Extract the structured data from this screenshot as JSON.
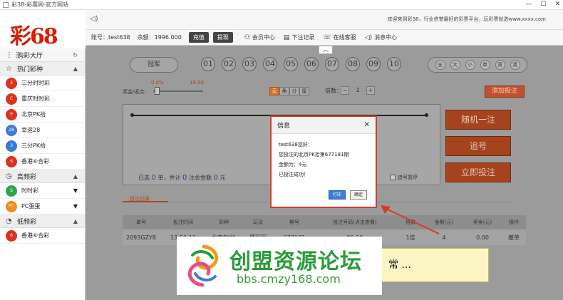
{
  "window": {
    "title": "彩38-彩票网-官方网站",
    "minimize": "—",
    "maximize": "☐",
    "close": "✕"
  },
  "logo": "彩68",
  "topbar": {
    "welcome": "欢迎来到彩38，行业信誉最好的彩票平台，玩彩票就选www.xxxx.com"
  },
  "account": {
    "user_label": "账号：test638",
    "balance_label": "余额：1996.000",
    "recharge": "充值",
    "withdraw": "提现",
    "links": [
      {
        "icon": "user-icon",
        "glyph": "⚇",
        "label": "会员中心"
      },
      {
        "icon": "book-icon",
        "glyph": "▤",
        "label": "下注记录"
      },
      {
        "icon": "headset-icon",
        "glyph": "☏",
        "label": "在线客服"
      },
      {
        "icon": "speaker-icon",
        "glyph": "◁)",
        "label": "消息中心"
      }
    ]
  },
  "sidebar": {
    "hall": "购彩大厅",
    "groups": [
      {
        "label": "热门彩种",
        "arrow": "▲",
        "icon": "star-icon",
        "glyph": "☆",
        "items": [
          "三分时时彩",
          "重庆时时彩",
          "北京PK拾",
          "幸运28",
          "三分PK拾",
          "香港⑥合彩"
        ]
      },
      {
        "label": "高频彩",
        "arrow": "▲",
        "icon": "clock-icon",
        "glyph": "◷",
        "items": [
          "时时彩",
          "PC蛋蛋"
        ]
      },
      {
        "label": "低频彩",
        "arrow": "▲",
        "icon": "timer-icon",
        "glyph": "◔",
        "items": [
          "香港⑥合彩"
        ]
      }
    ]
  },
  "game": {
    "position_pill": "冠军",
    "numbers": [
      "01",
      "02",
      "03",
      "04",
      "05",
      "06",
      "07",
      "08",
      "09",
      "10"
    ],
    "quick_picks": [
      "全",
      "大",
      "小",
      "单",
      "双",
      "清"
    ],
    "rebate_label": "奖金/返点：",
    "rebate_min": "0.0%",
    "rebate_max": "19.00",
    "units": [
      "元",
      "角",
      "分",
      "厘"
    ],
    "multiplier_label": "倍数：",
    "multiplier_minus": "−",
    "multiplier_value": "1",
    "multiplier_plus": "+",
    "add_bet": "添加投注",
    "selected_prefix": "已选",
    "selected_count": "0",
    "selected_mid": "单，共计",
    "total_count": "0",
    "total_mid": "注总金额",
    "total_amount": "0",
    "currency": "元",
    "stop_chase": "追号暂停",
    "random_one": "随机一注",
    "chase_number": "追号",
    "bet_now": "立即投注",
    "records_tab": "投注记录"
  },
  "table": {
    "headers": [
      "单号",
      "投注时间",
      "彩种",
      "玩法",
      "期号",
      "投注号码(点击查看)",
      "倍数",
      "金额(元)",
      "奖金(元)",
      "操作"
    ],
    "rows": [
      [
        "2093GZY8",
        "13:50:12",
        "北京PK拾",
        "猜冠军",
        "677181",
        "09,10",
        "1倍",
        "4",
        "0.00",
        "撤单"
      ]
    ]
  },
  "dialog": {
    "title": "信息",
    "close": "✕",
    "lines": [
      "test638您好：",
      "您投注的北京PK拾第677181期",
      "金额为：4元",
      "已投注成功！"
    ],
    "print": "打印",
    "ok": "确定"
  },
  "callout": "常 ...",
  "watermark": {
    "title": "创盟资源论坛",
    "url": "bbs.cmzy168.com"
  }
}
